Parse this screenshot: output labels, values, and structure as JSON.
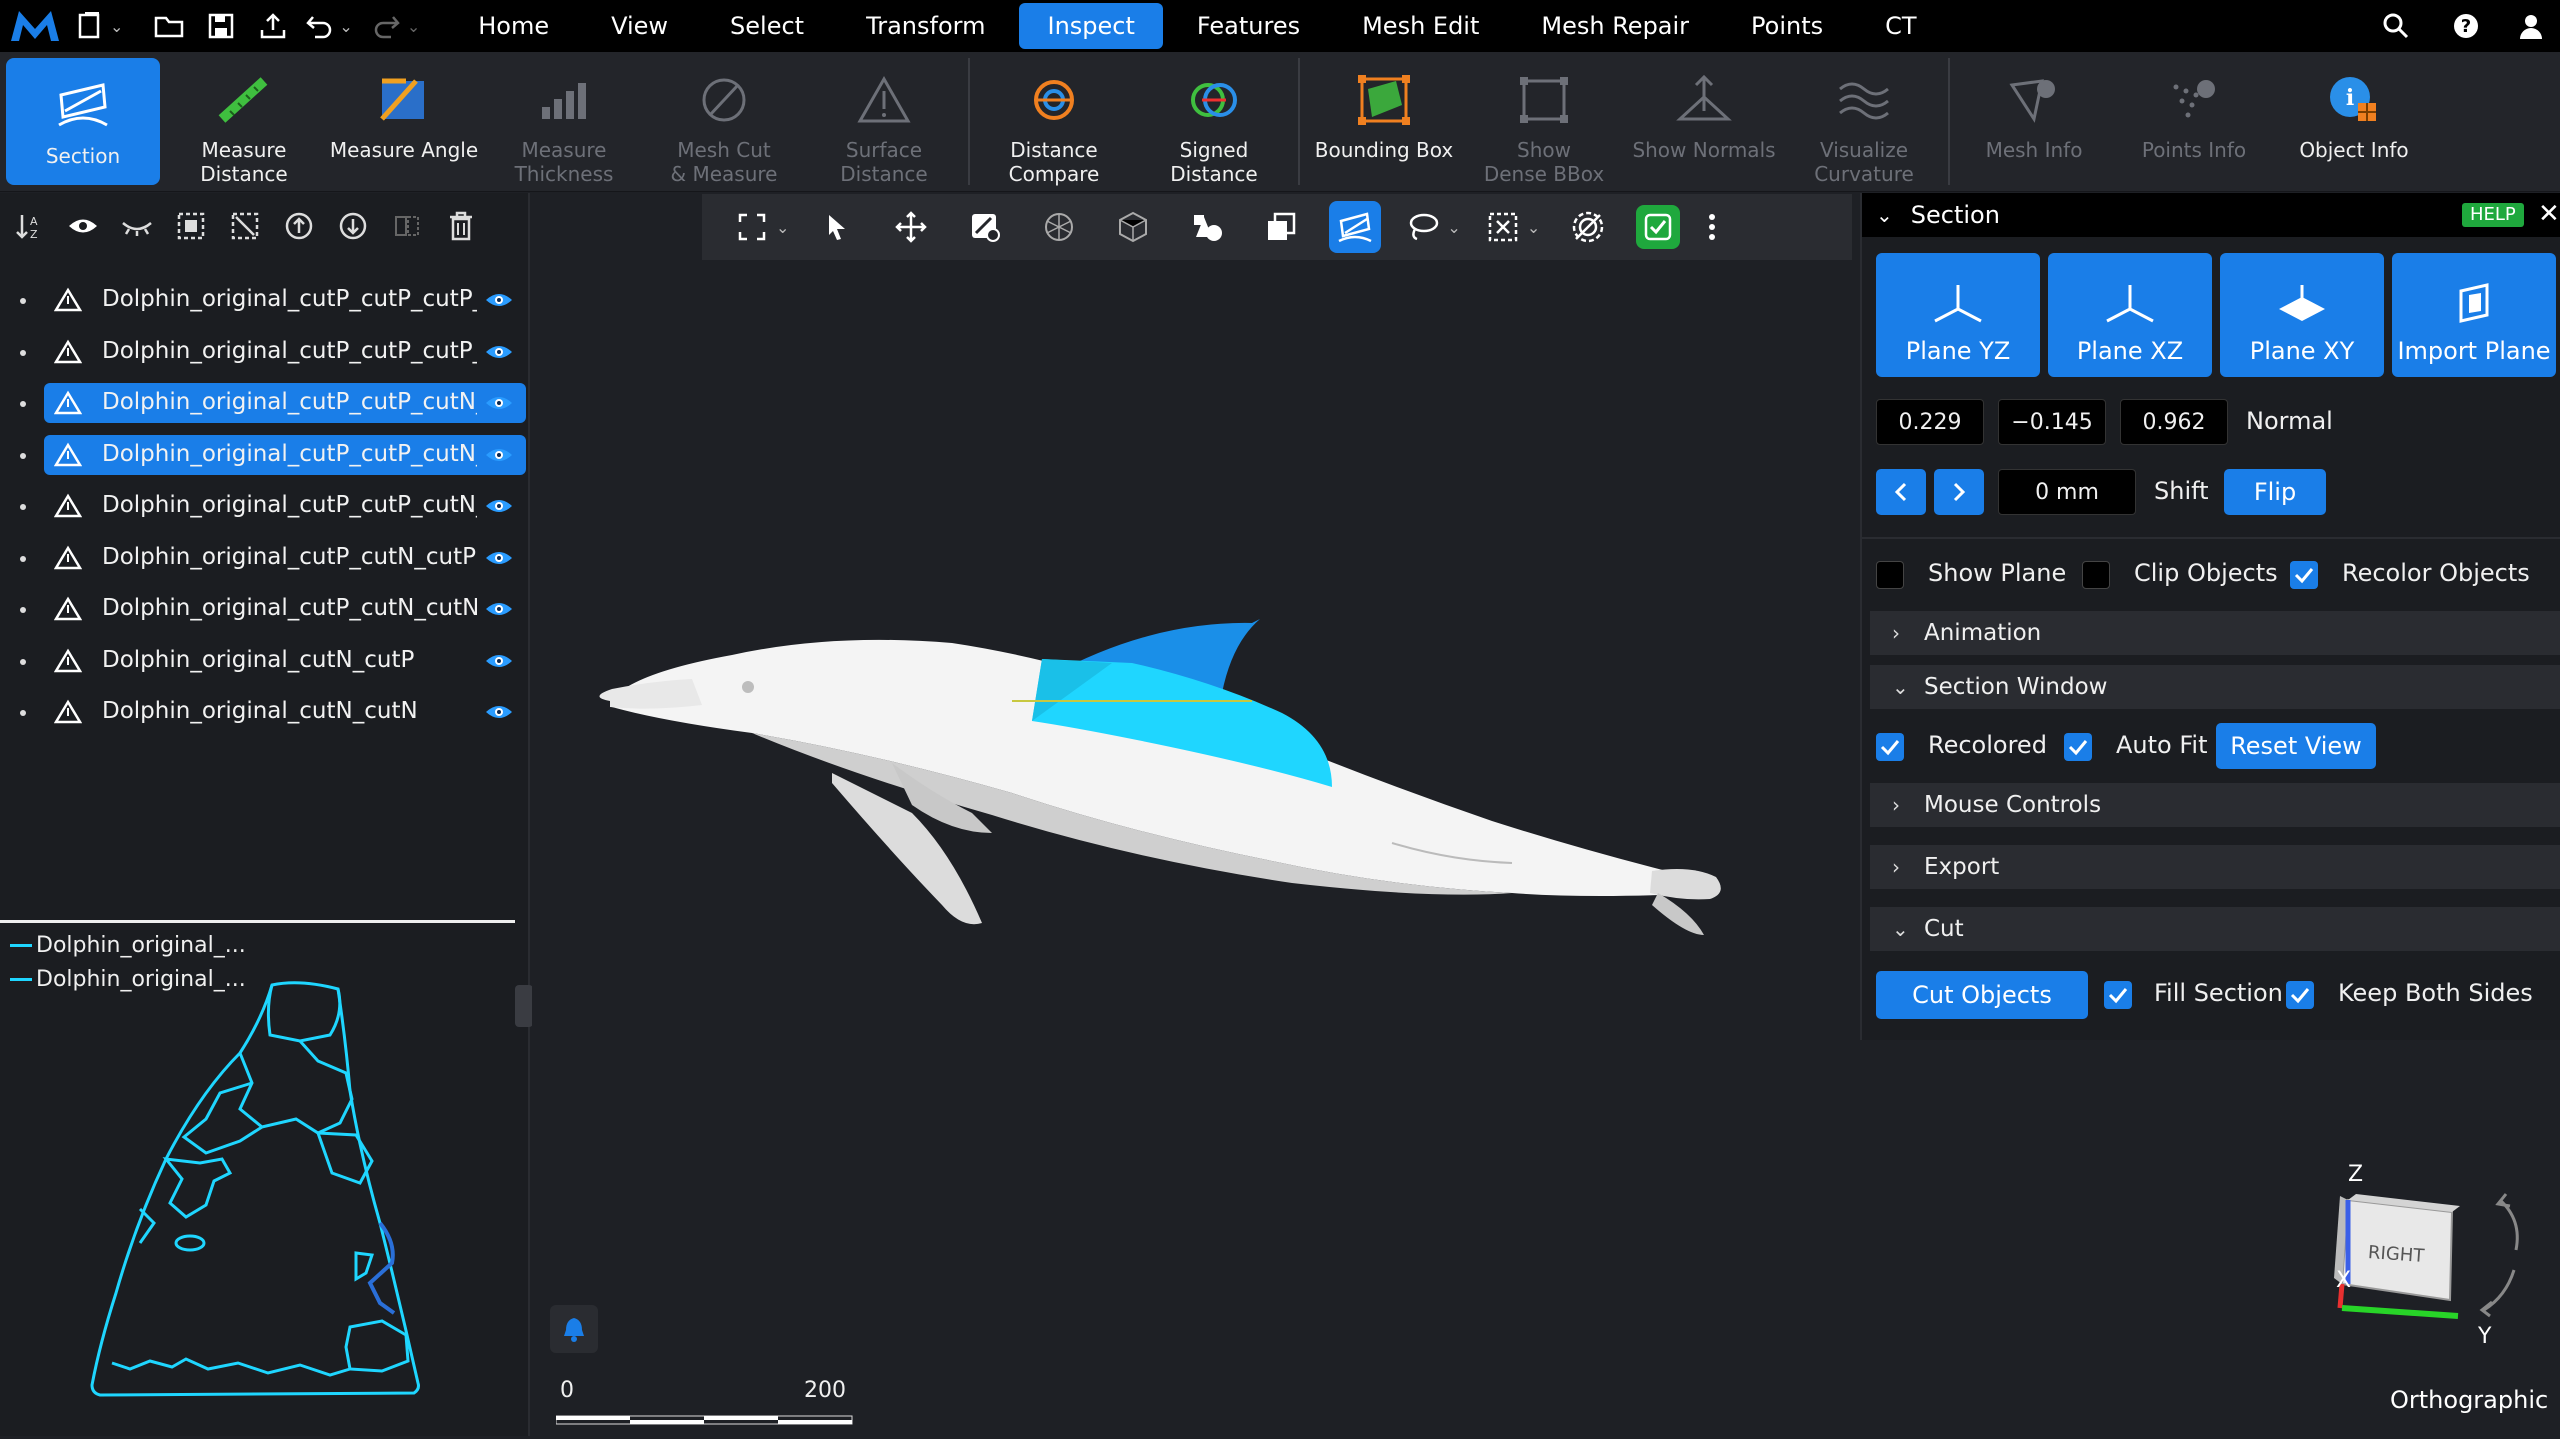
{
  "menubar": {
    "tabs": [
      "Home",
      "View",
      "Select",
      "Transform",
      "Inspect",
      "Features",
      "Mesh Edit",
      "Mesh Repair",
      "Points",
      "CT"
    ],
    "active_tab": "Inspect"
  },
  "ribbon": {
    "items": [
      {
        "label": "Section",
        "state": "active"
      },
      {
        "label": "Measure\nDistance",
        "state": "enabled"
      },
      {
        "label": "Measure Angle",
        "state": "enabled"
      },
      {
        "label": "Measure\nThickness",
        "state": "disabled"
      },
      {
        "label": "Mesh Cut\n& Measure",
        "state": "disabled"
      },
      {
        "label": "Surface\nDistance",
        "state": "disabled"
      },
      {
        "label": "Distance\nCompare",
        "state": "enabled"
      },
      {
        "label": "Signed\nDistance",
        "state": "enabled"
      },
      {
        "label": "Bounding Box",
        "state": "enabled"
      },
      {
        "label": "Show\nDense BBox",
        "state": "disabled"
      },
      {
        "label": "Show Normals",
        "state": "disabled"
      },
      {
        "label": "Visualize\nCurvature",
        "state": "disabled"
      },
      {
        "label": "Mesh Info",
        "state": "disabled"
      },
      {
        "label": "Points Info",
        "state": "disabled"
      },
      {
        "label": "Object Info",
        "state": "enabled"
      }
    ]
  },
  "scene": {
    "objects": [
      {
        "name": "Dolphin_original_cutP_cutP_cutP_cutP",
        "selected": false
      },
      {
        "name": "Dolphin_original_cutP_cutP_cutP_cutN",
        "selected": false
      },
      {
        "name": "Dolphin_original_cutP_cutP_cutN_cutP",
        "selected": true
      },
      {
        "name": "Dolphin_original_cutP_cutP_cutN_cutN",
        "selected": true
      },
      {
        "name": "Dolphin_original_cutP_cutP_cutN_",
        "selected": false
      },
      {
        "name": "Dolphin_original_cutP_cutN_cutP",
        "selected": false
      },
      {
        "name": "Dolphin_original_cutP_cutN_cutN",
        "selected": false
      },
      {
        "name": "Dolphin_original_cutN_cutP",
        "selected": false
      },
      {
        "name": "Dolphin_original_cutN_cutN",
        "selected": false
      }
    ]
  },
  "section_view": {
    "legend": [
      "Dolphin_original_...",
      "Dolphin_original_..."
    ]
  },
  "section_panel": {
    "title": "Section",
    "help": "HELP",
    "planes": [
      "Plane YZ",
      "Plane XZ",
      "Plane XY",
      "Import Plane"
    ],
    "normal": {
      "x": "0.229",
      "y": "−0.145",
      "z": "0.962",
      "label": "Normal"
    },
    "shift": {
      "value": "0 mm",
      "label": "Shift",
      "flip": "Flip"
    },
    "options": {
      "show_plane": "Show Plane",
      "clip_objects": "Clip Objects",
      "recolor_objects": "Recolor Objects"
    },
    "animation": "Animation",
    "section_window": {
      "title": "Section Window",
      "recolored": "Recolored",
      "auto_fit": "Auto Fit",
      "reset_view": "Reset View"
    },
    "mouse_controls": "Mouse Controls",
    "export": "Export",
    "cut": {
      "title": "Cut",
      "cut_objects": "Cut Objects",
      "fill_section": "Fill Section",
      "keep_both_sides": "Keep Both Sides"
    }
  },
  "scale": {
    "min": "0",
    "max": "200"
  },
  "navcube": {
    "face": "RIGHT",
    "axis_z": "Z",
    "axis_x": "X",
    "axis_y": "Y"
  },
  "projection": "Orthographic",
  "colors": {
    "accent": "#1a7ee8",
    "section_cyan": "#1fd6ff",
    "help_green": "#1fa83d"
  }
}
